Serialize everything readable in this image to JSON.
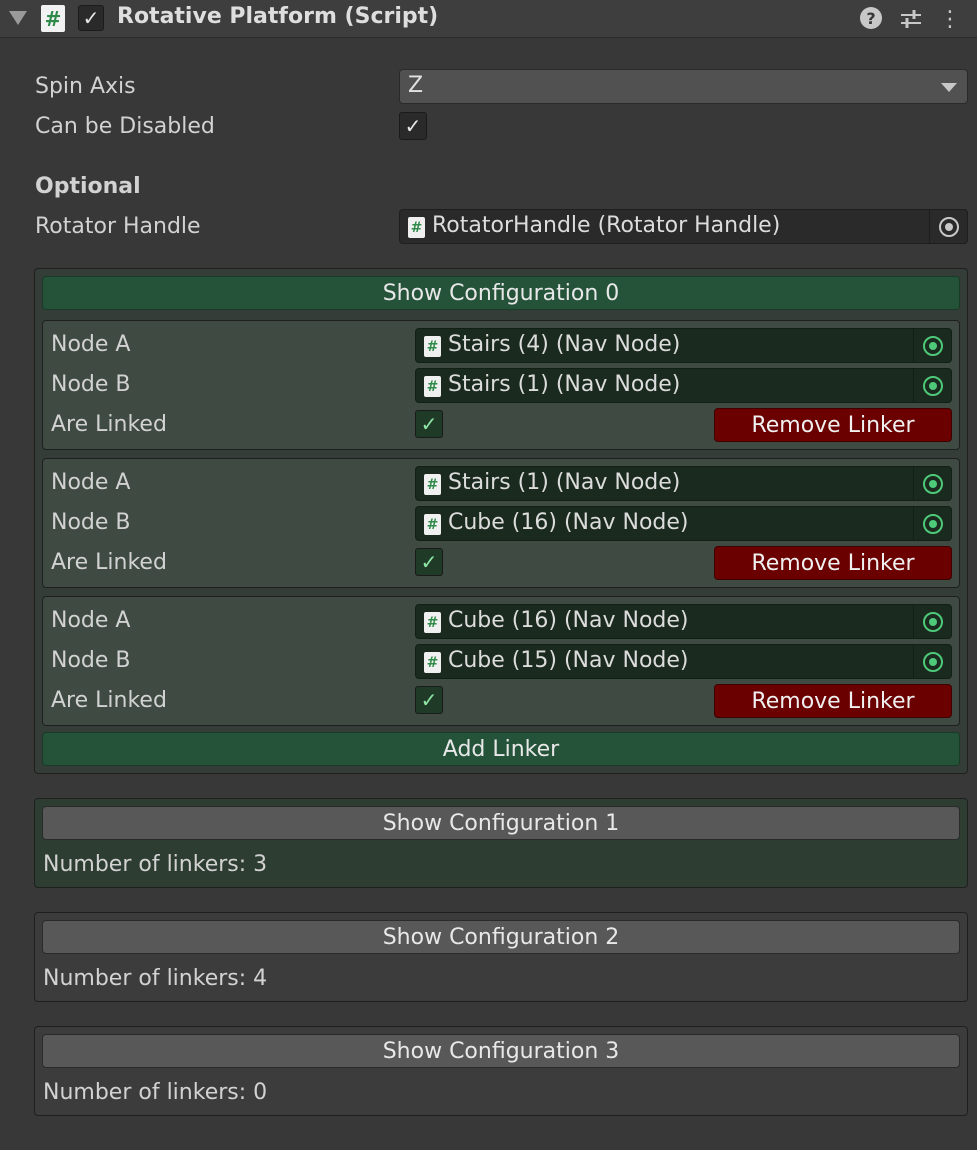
{
  "header": {
    "title": "Rotative Platform (Script)",
    "script_icon_glyph": "#",
    "enabled": true,
    "icons": [
      "foldout-arrow-icon",
      "script-icon",
      "help-icon",
      "preset-icon",
      "menu-icon"
    ]
  },
  "fields": {
    "spin_axis_label": "Spin Axis",
    "spin_axis_value": "Z",
    "can_be_disabled_label": "Can be Disabled",
    "can_be_disabled_checked": true,
    "optional_header": "Optional",
    "rotator_handle_label": "Rotator Handle",
    "rotator_handle_value": "RotatorHandle (Rotator Handle)"
  },
  "config0": {
    "button_label": "Show Configuration 0",
    "linkers": [
      {
        "node_a_label": "Node A",
        "node_a": "Stairs (4) (Nav Node)",
        "node_b_label": "Node B",
        "node_b": "Stairs (1) (Nav Node)",
        "linked_label": "Are Linked",
        "linked": true,
        "remove_label": "Remove Linker"
      },
      {
        "node_a_label": "Node A",
        "node_a": "Stairs (1) (Nav Node)",
        "node_b_label": "Node B",
        "node_b": "Cube (16) (Nav Node)",
        "linked_label": "Are Linked",
        "linked": true,
        "remove_label": "Remove Linker"
      },
      {
        "node_a_label": "Node A",
        "node_a": "Cube (16) (Nav Node)",
        "node_b_label": "Node B",
        "node_b": "Cube (15) (Nav Node)",
        "linked_label": "Are Linked",
        "linked": true,
        "remove_label": "Remove Linker"
      }
    ],
    "add_label": "Add Linker"
  },
  "configs": [
    {
      "button_label": "Show Configuration 1",
      "count_text": "Number of linkers: 3"
    },
    {
      "button_label": "Show Configuration 2",
      "count_text": "Number of linkers: 4"
    },
    {
      "button_label": "Show Configuration 3",
      "count_text": "Number of linkers: 0"
    }
  ],
  "colors": {
    "background": "#383838",
    "green_button": "#25533a",
    "red_button": "#6b0000",
    "accent_green": "#4ec97a"
  }
}
